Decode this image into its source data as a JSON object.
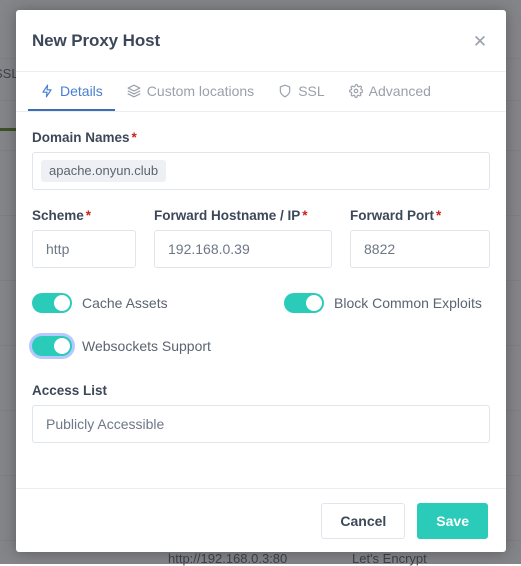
{
  "background": {
    "partial_label": "SSL",
    "forward_text": "http://192.168.0.3:80",
    "cert_text": "Let's Encrypt"
  },
  "modal": {
    "title": "New Proxy Host",
    "close_icon": "close-icon",
    "tabs": [
      {
        "label": "Details",
        "icon": "bolt-icon",
        "active": true
      },
      {
        "label": "Custom locations",
        "icon": "layers-icon",
        "active": false
      },
      {
        "label": "SSL",
        "icon": "shield-icon",
        "active": false
      },
      {
        "label": "Advanced",
        "icon": "gear-icon",
        "active": false
      }
    ],
    "fields": {
      "domain_names": {
        "label": "Domain Names",
        "required": "*",
        "tags": [
          "apache.onyun.club"
        ]
      },
      "scheme": {
        "label": "Scheme",
        "required": "*",
        "value": "http"
      },
      "forward_hostname": {
        "label": "Forward Hostname / IP",
        "required": "*",
        "value": "192.168.0.39"
      },
      "forward_port": {
        "label": "Forward Port",
        "required": "*",
        "value": "8822"
      },
      "access_list": {
        "label": "Access List",
        "value": "Publicly Accessible"
      }
    },
    "toggles": [
      {
        "label": "Cache Assets",
        "on": true,
        "focused": false
      },
      {
        "label": "Block Common Exploits",
        "on": true,
        "focused": false
      },
      {
        "label": "Websockets Support",
        "on": true,
        "focused": true
      }
    ],
    "footer": {
      "cancel_label": "Cancel",
      "save_label": "Save"
    }
  },
  "colors": {
    "accent_teal": "#2bcbba",
    "accent_blue": "#467fcf",
    "required_red": "#cd201f",
    "text_dark": "#3c4858",
    "text_muted": "#9aa0ac"
  }
}
